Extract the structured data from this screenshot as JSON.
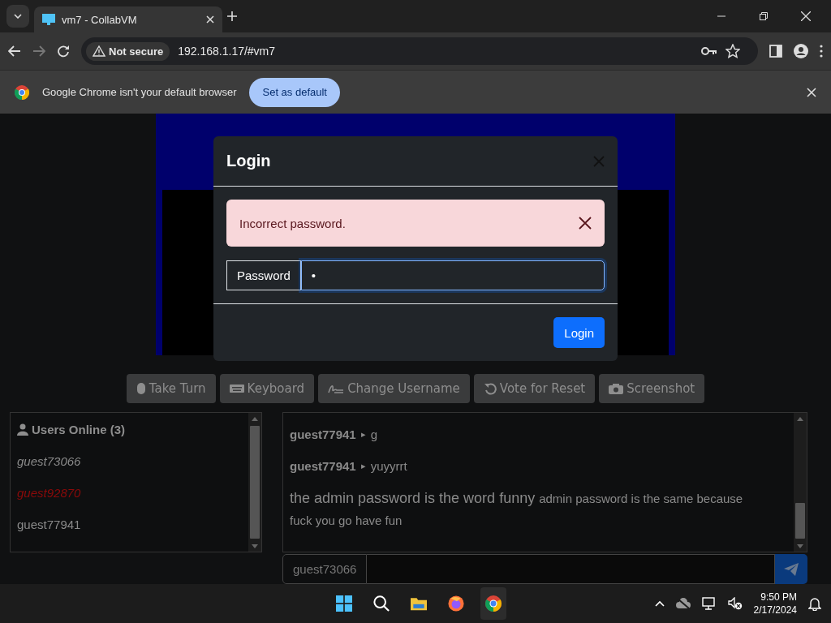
{
  "browser": {
    "tab_title": "vm7 - CollabVM",
    "security_label": "Not secure",
    "url": "192.168.1.17/#vm7"
  },
  "infobar": {
    "message": "Google Chrome isn't your default browser",
    "button": "Set as default"
  },
  "modal": {
    "title": "Login",
    "alert": "Incorrect password.",
    "field_label": "Password",
    "field_value": "•",
    "submit": "Login"
  },
  "actions": [
    {
      "kind": "turn",
      "label": "Take Turn"
    },
    {
      "kind": "keyboard",
      "label": "Keyboard"
    },
    {
      "kind": "rename",
      "label": "Change Username"
    },
    {
      "kind": "reset",
      "label": "Vote for Reset"
    },
    {
      "kind": "screenshot",
      "label": "Screenshot"
    }
  ],
  "users": {
    "title": "Users Online (3)",
    "items": [
      {
        "name": "guest73066",
        "italic": true,
        "color": "#8a8a8a"
      },
      {
        "name": "guest92870",
        "italic": true,
        "color": "#8b0a0a"
      },
      {
        "name": "guest77941",
        "italic": false,
        "color": "#8a8a8a"
      }
    ]
  },
  "chat": {
    "messages": [
      {
        "kind": "user",
        "user": "guest77941",
        "arrow": "▸",
        "text": "g"
      },
      {
        "kind": "user",
        "user": "guest77941",
        "arrow": "▸",
        "text": "yuyyrrt"
      },
      {
        "kind": "plain",
        "text": "the admin password is the word funny",
        "small_text": "admin password is the same because fuck you go have fun"
      }
    ],
    "username": "guest73066"
  },
  "taskbar": {
    "time": "9:50 PM",
    "date": "2/17/2024"
  }
}
